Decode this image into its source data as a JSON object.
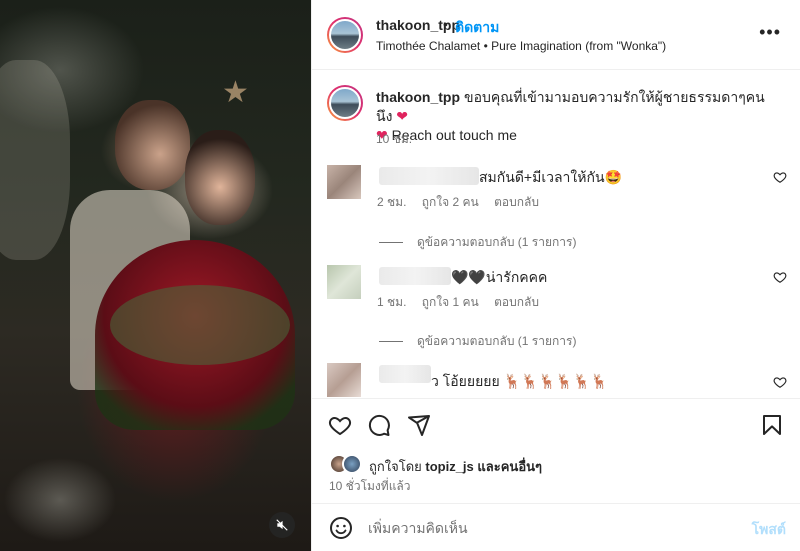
{
  "header": {
    "username": "thakoon_tpp",
    "separator": "•",
    "follow_label": "ติดตาม",
    "audio": "Timothée Chalamet • Pure Imagination (from \"Wonka\")",
    "more_label": "•••"
  },
  "caption": {
    "username": "thakoon_tpp",
    "text": "ขอบคุณที่เข้ามามอบความรักให้ผู้ชายธรรมดาๆคนนึง",
    "heart": "❤",
    "text2": "Reach out touch me",
    "time": "10 ชม."
  },
  "comments": [
    {
      "text": "สมกันดี+มีเวลาให้กัน🤩",
      "time": "2 ชม.",
      "likes": "ถูกใจ 2 คน",
      "reply": "ตอบกลับ",
      "view_replies": "ดูข้อความตอบกลับ (1 รายการ)"
    },
    {
      "text": "🖤🖤น่ารักคคค",
      "time": "1 ชม.",
      "likes": "ถูกใจ 1 คน",
      "reply": "ตอบกลับ",
      "view_replies": "ดูข้อความตอบกลับ (1 รายการ)"
    },
    {
      "text": "ว โอ้ยยยยย 🦌🦌🦌🦌🦌🦌"
    }
  ],
  "likes": {
    "prefix": "ถูกใจโดย",
    "user": "topiz_js",
    "suffix": "และคนอื่นๆ"
  },
  "post_time": "10 ชั่วโมงที่แล้ว",
  "add_comment": {
    "placeholder": "เพิ่มความคิดเห็น",
    "post_label": "โพสต์"
  },
  "colors": {
    "accent": "#0095f6",
    "post_disabled": "#b2dffc",
    "heart": "#e0245e"
  }
}
